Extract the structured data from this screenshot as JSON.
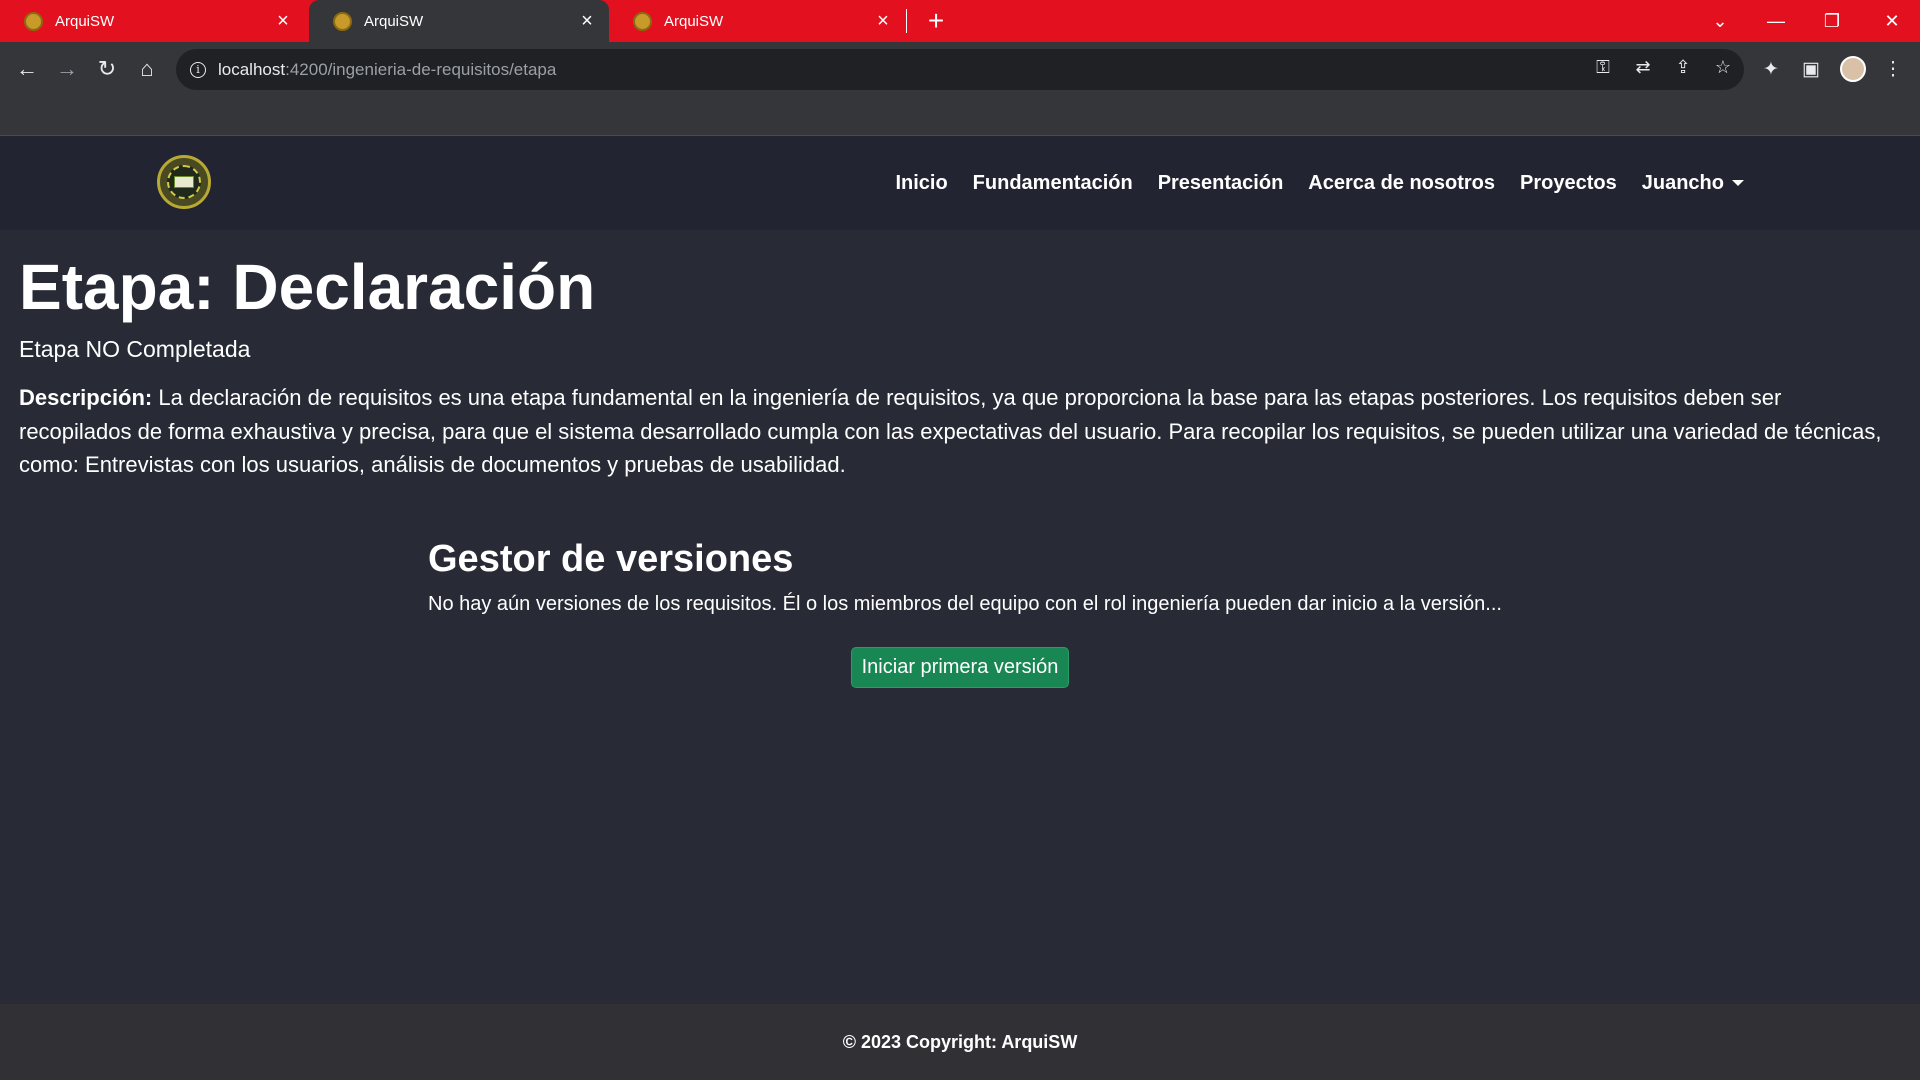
{
  "browser": {
    "tabs": [
      {
        "title": "ArquiSW",
        "active": false
      },
      {
        "title": "ArquiSW",
        "active": true
      },
      {
        "title": "ArquiSW",
        "active": false
      }
    ],
    "url_host": "localhost",
    "url_path": ":4200/ingenieria-de-requisitos/etapa",
    "accent_color": "#e3111f"
  },
  "navbar": {
    "links": [
      "Inicio",
      "Fundamentación",
      "Presentación",
      "Acerca de nosotros",
      "Proyectos"
    ],
    "user": "Juancho"
  },
  "page": {
    "title": "Etapa: Declaración",
    "status": "Etapa NO Completada",
    "description_label": "Descripción:",
    "description_text": " La declaración de requisitos es una etapa fundamental en la ingeniería de requisitos, ya que proporciona la base para las etapas posteriores. Los requisitos deben ser recopilados de forma exhaustiva y precisa, para que el sistema desarrollado cumpla con las expectativas del usuario. Para recopilar los requisitos, se pueden utilizar una variedad de técnicas, como: Entrevistas con los usuarios, análisis de documentos y pruebas de usabilidad."
  },
  "versions": {
    "title": "Gestor de versiones",
    "message": "No hay aún versiones de los requisitos. Él o los miembros del equipo con el rol ingeniería pueden dar inicio a la versión...",
    "button_label": "Iniciar primera versión",
    "button_color": "#198754"
  },
  "footer": {
    "text": "© 2023 Copyright: ArquiSW"
  }
}
